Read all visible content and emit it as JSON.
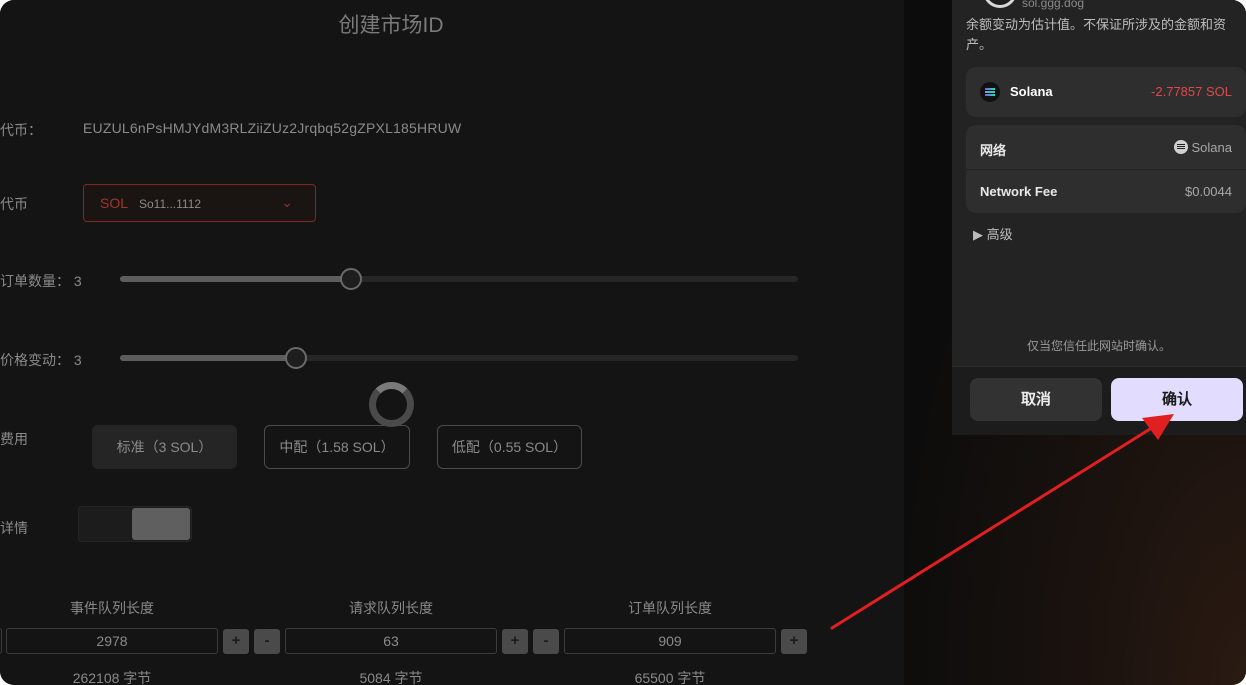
{
  "main": {
    "title": "创建市场ID",
    "base_token": {
      "label": "代币：",
      "address": "EUZUL6nPsHMJYdM3RLZiiZUz2Jrqbq52gZPXL185HRUW"
    },
    "quote_token": {
      "label": "代币",
      "symbol": "SOL",
      "address": "So11...1112"
    },
    "min_order_size": {
      "label": "订单数量：",
      "value": "3",
      "level": 0.34
    },
    "min_price_tick": {
      "label": "价格变动：",
      "value": "3",
      "level": 0.26
    },
    "fee": {
      "label": "费用",
      "options": [
        "标准（3 SOL）",
        "中配（1.58 SOL）",
        "低配（0.55 SOL）"
      ]
    },
    "details": {
      "label": "详情",
      "enabled": true
    },
    "queues": [
      {
        "label": "事件队列长度",
        "value": "2978",
        "bytes": "262108 字节"
      },
      {
        "label": "请求队列长度",
        "value": "63",
        "bytes": "5084 字节"
      },
      {
        "label": "订单队列长度",
        "value": "909",
        "bytes": "65500 字节"
      }
    ],
    "plus": "+",
    "minus": "-"
  },
  "wallet": {
    "name": "sol.ggg.dog",
    "warning": "余额变动为估计值。不保证所涉及的金额和资产。",
    "asset": {
      "name": "Solana",
      "delta": "-2.77857 SOL"
    },
    "network": {
      "label": "网络",
      "value": "Solana"
    },
    "network_fee": {
      "label": "Network Fee",
      "value": "$0.0044"
    },
    "advanced": "▶  高级",
    "trust_note": "仅当您信任此网站时确认。",
    "cancel": "取消",
    "confirm": "确认"
  },
  "colors": {
    "accent": "#e2dcff",
    "negative": "#e0474c",
    "arrow": "#e02020"
  }
}
